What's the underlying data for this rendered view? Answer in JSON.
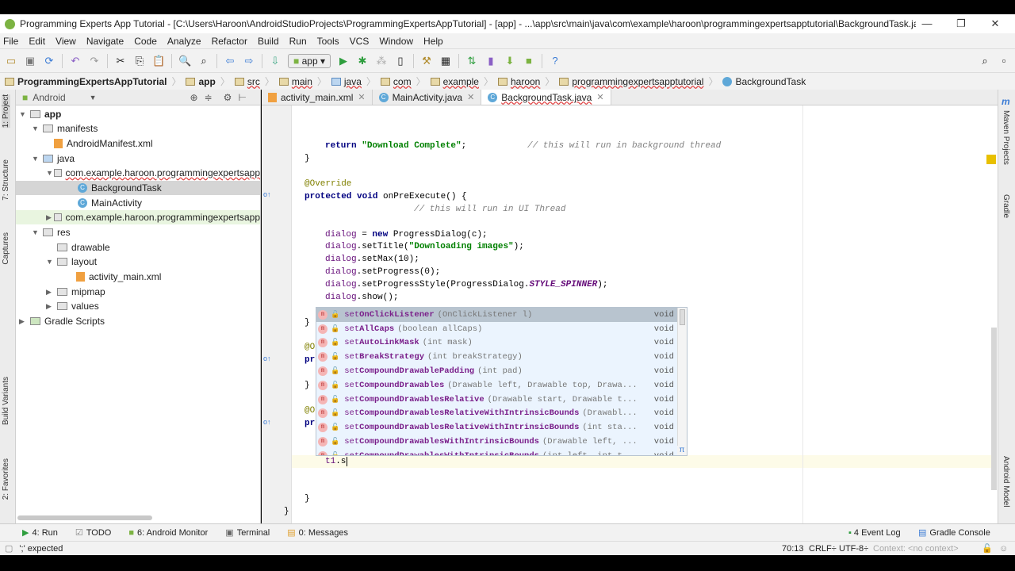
{
  "window": {
    "title": "Programming Experts App Tutorial - [C:\\Users\\Haroon\\AndroidStudioProjects\\ProgrammingExpertsAppTutorial] - [app] - ...\\app\\src\\main\\java\\com\\example\\haroon\\programmingexpertsapptutorial\\BackgroundTask.java - An..."
  },
  "menu": [
    "File",
    "Edit",
    "View",
    "Navigate",
    "Code",
    "Analyze",
    "Refactor",
    "Build",
    "Run",
    "Tools",
    "VCS",
    "Window",
    "Help"
  ],
  "toolbar": {
    "run_config": "app"
  },
  "breadcrumb": [
    "ProgrammingExpertsAppTutorial",
    "app",
    "src",
    "main",
    "java",
    "com",
    "example",
    "haroon",
    "programmingexpertsapptutorial",
    "BackgroundTask"
  ],
  "project_panel": {
    "view": "Android",
    "tree": [
      {
        "label": "app",
        "type": "folder"
      },
      {
        "label": "manifests",
        "type": "folder"
      },
      {
        "label": "AndroidManifest.xml",
        "type": "xml"
      },
      {
        "label": "java",
        "type": "folder"
      },
      {
        "label": "com.example.haroon.programmingexpertsapp",
        "type": "package"
      },
      {
        "label": "BackgroundTask",
        "type": "class"
      },
      {
        "label": "MainActivity",
        "type": "class"
      },
      {
        "label": "com.example.haroon.programmingexpertsapp",
        "type": "package"
      },
      {
        "label": "res",
        "type": "folder"
      },
      {
        "label": "drawable",
        "type": "folder"
      },
      {
        "label": "layout",
        "type": "folder"
      },
      {
        "label": "activity_main.xml",
        "type": "xml"
      },
      {
        "label": "mipmap",
        "type": "folder"
      },
      {
        "label": "values",
        "type": "folder"
      },
      {
        "label": "Gradle Scripts",
        "type": "folder"
      }
    ]
  },
  "left_tool_tabs": [
    "1: Project",
    "7: Structure",
    "Captures",
    "Build Variants",
    "2: Favorites"
  ],
  "right_tool_tabs": [
    "Maven Projects",
    "Gradle",
    "Android Model"
  ],
  "editor_tabs": [
    {
      "label": "activity_main.xml",
      "active": false
    },
    {
      "label": "MainActivity.java",
      "active": false
    },
    {
      "label": "BackgroundTask.java",
      "active": true
    }
  ],
  "code": {
    "l1a": "return ",
    "l1b": "\"Download Complete\"",
    "l1c": ";",
    "l1d": "// this will run in background thread",
    "l2": "}",
    "l3": "@Override",
    "l4a": "protected void ",
    "l4b": "onPreExecute() {",
    "l5": "// this will run in UI Thread",
    "l6a": "dialog",
    " l6b": "",
    "l6c": " = ",
    "l6d": "new ",
    "l6e": "ProgressDialog(c);",
    "l7a": "dialog",
    ".l7": "",
    "l7b": ".setTitle(",
    "l7c": "\"Downloading images\"",
    "l7d": ");",
    "l8a": "dialog",
    "l8b": ".setMax(10);",
    "l9a": "dialog",
    "l9b": ".setProgress(0);",
    "l10a": "dialog",
    "l10b": ".setProgressStyle(ProgressDialog.",
    "l10c": "STYLE_SPINNER",
    "l10d": ");",
    "l11a": "dialog",
    "l11b": ".show();",
    "l12": "}",
    "l13": "@O",
    "l14": "pr",
    "l15": "}",
    "l16": "@O",
    "l17": "pr",
    "l18a": "t1",
    "l18b": ".s",
    "l19": "}",
    "l20": "}"
  },
  "completion": [
    {
      "name_pre": "set",
      "name_bold": "OnClickListener",
      "params": "(OnClickListener l)",
      "ret": "void"
    },
    {
      "name_pre": "set",
      "name_bold": "AllCaps",
      "params": "(boolean allCaps)",
      "ret": "void"
    },
    {
      "name_pre": "set",
      "name_bold": "AutoLinkMask",
      "params": "(int mask)",
      "ret": "void"
    },
    {
      "name_pre": "set",
      "name_bold": "BreakStrategy",
      "params": "(int breakStrategy)",
      "ret": "void"
    },
    {
      "name_pre": "set",
      "name_bold": "CompoundDrawablePadding",
      "params": "(int pad)",
      "ret": "void"
    },
    {
      "name_pre": "set",
      "name_bold": "CompoundDrawables",
      "params": "(Drawable left, Drawable top, Drawa...",
      "ret": "void"
    },
    {
      "name_pre": "set",
      "name_bold": "CompoundDrawablesRelative",
      "params": "(Drawable start, Drawable t...",
      "ret": "void"
    },
    {
      "name_pre": "set",
      "name_bold": "CompoundDrawablesRelativeWithIntrinsicBounds",
      "params": "(Drawabl...",
      "ret": "void"
    },
    {
      "name_pre": "set",
      "name_bold": "CompoundDrawablesRelativeWithIntrinsicBounds",
      "params": "(int sta...",
      "ret": "void"
    },
    {
      "name_pre": "set",
      "name_bold": "CompoundDrawablesWithIntrinsicBounds",
      "params": "(Drawable left, ...",
      "ret": "void"
    },
    {
      "name_pre": "set",
      "name_bold": "CompoundDrawablesWithIntrinsicBounds",
      "params": "(int left, int t...",
      "ret": "void"
    }
  ],
  "bottom_tools": [
    "4: Run",
    "TODO",
    "6: Android Monitor",
    "Terminal",
    "0: Messages"
  ],
  "bottom_tools_right": [
    "4 Event Log",
    "Gradle Console"
  ],
  "status": {
    "message": "';' expected",
    "position": "70:13",
    "line_sep": "CRLF÷",
    "encoding": "UTF-8÷",
    "context": "Context: <no context>"
  }
}
